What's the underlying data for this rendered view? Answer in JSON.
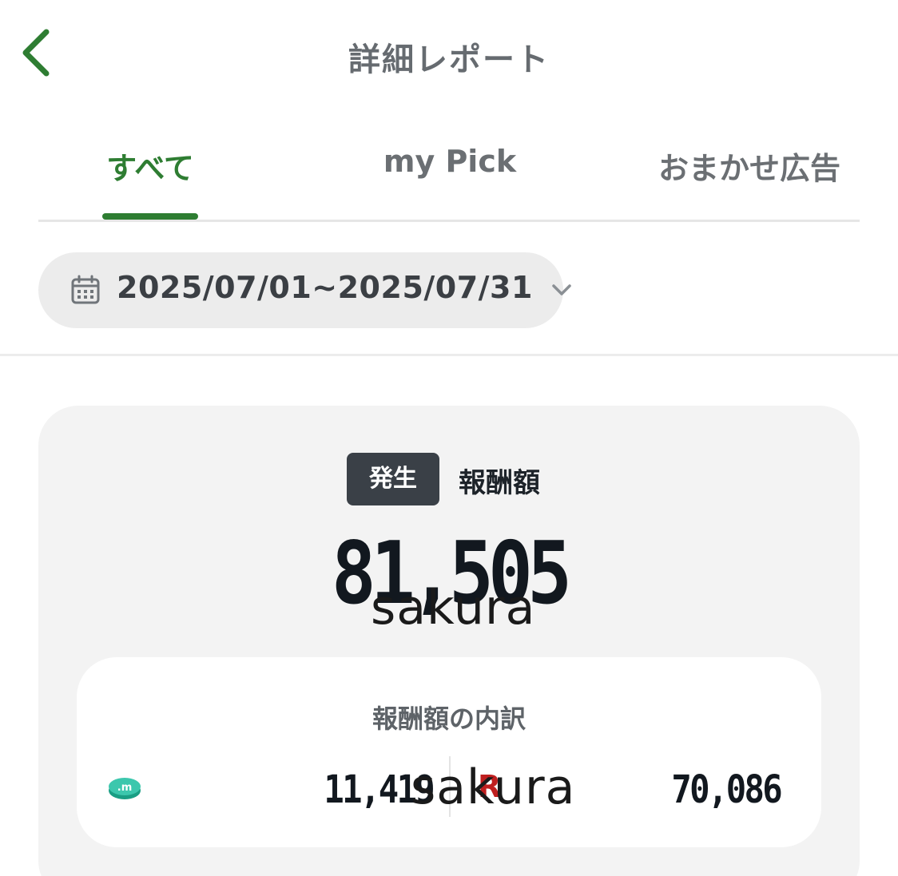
{
  "header": {
    "title": "詳細レポート",
    "back_icon": "chevron-left-icon",
    "accent_color": "#2e7d32"
  },
  "tabs": [
    {
      "label": "すべて",
      "active": true
    },
    {
      "label": "my Pick",
      "active": false
    },
    {
      "label": "おまかせ広告",
      "active": false
    }
  ],
  "date_filter": {
    "icon": "calendar-icon",
    "range": "2025/07/01~2025/07/31",
    "dropdown_icon": "chevron-down-icon"
  },
  "summary": {
    "badge": "発生",
    "label": "報酬額",
    "total": "81,505",
    "watermark": "sakura"
  },
  "breakdown": {
    "title": "報酬額の内訳",
    "left": {
      "icon": "coin-m-icon",
      "value": "11,419"
    },
    "right": {
      "icon": "rakuten-r-icon",
      "mark": "R",
      "value": "70,086"
    },
    "watermark": "sakura"
  }
}
